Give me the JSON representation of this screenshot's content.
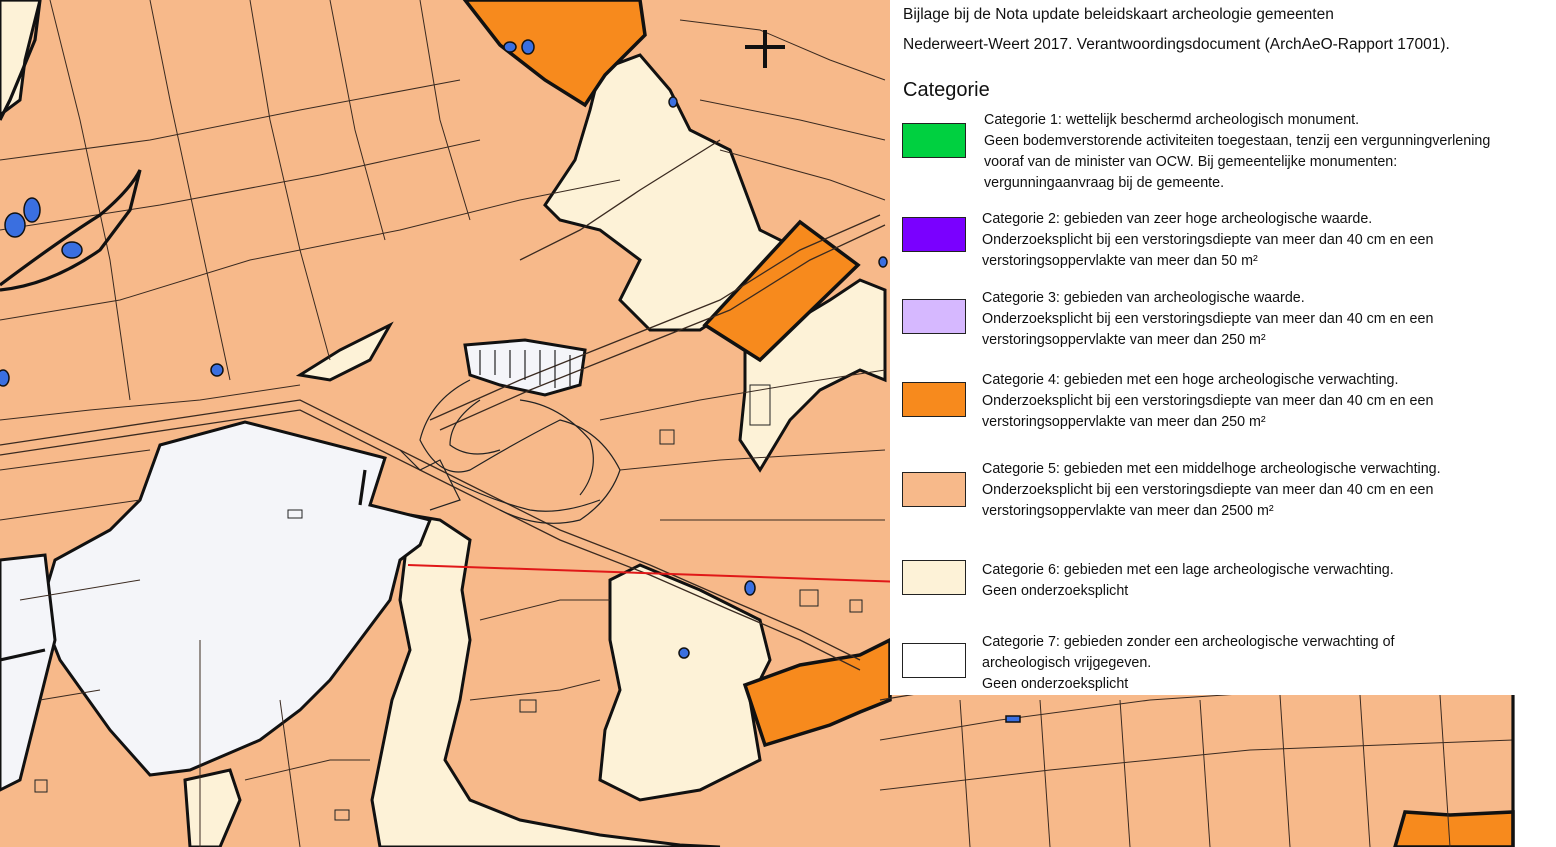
{
  "legend": {
    "header_line1": "Bijlage bij de Nota update beleidskaart archeologie gemeenten",
    "header_line2": "Nederweert-Weert 2017. Verantwoordingsdocument (ArchAeO-Rapport 17001).",
    "title": "Categorie",
    "entries": [
      {
        "color": "#00d040",
        "lines": [
          "Categorie 1: wettelijk beschermd archeologisch monument.",
          "Geen bodemverstorende activiteiten toegestaan, tenzij een vergunningverlening",
          "vooraf van de minister van OCW. Bij gemeentelijke monumenten:",
          "vergunningaanvraag bij de gemeente."
        ]
      },
      {
        "color": "#7a00ff",
        "lines": [
          "Categorie 2: gebieden van zeer hoge archeologische waarde.",
          "Onderzoeksplicht bij een verstoringsdiepte van meer dan 40 cm en een",
          "verstoringsoppervlakte van meer dan 50 m²"
        ]
      },
      {
        "color": "#d6b8ff",
        "lines": [
          "Categorie 3: gebieden van archeologische waarde.",
          "Onderzoeksplicht bij een verstoringsdiepte van meer dan 40 cm en een",
          "verstoringsoppervlakte van meer dan 250 m²"
        ]
      },
      {
        "color": "#f78a1d",
        "lines": [
          "Categorie 4: gebieden met een hoge archeologische verwachting.",
          "Onderzoeksplicht bij een verstoringsdiepte van meer dan 40 cm en een",
          "verstoringsoppervlakte van meer dan 250 m²"
        ]
      },
      {
        "color": "#f7b98a",
        "lines": [
          "Categorie 5: gebieden met een middelhoge archeologische verwachting.",
          "Onderzoeksplicht bij een verstoringsdiepte van meer dan 40 cm en een",
          "verstoringsoppervlakte van meer dan 2500 m²"
        ]
      },
      {
        "color": "#fdf2d7",
        "lines": [
          "Categorie 6: gebieden met een lage archeologische verwachting.",
          "Geen onderzoeksplicht"
        ]
      },
      {
        "color": "#ffffff",
        "lines": [
          "Categorie 7: gebieden zonder een archeologische verwachting of",
          "archeologisch vrijgegeven.",
          "Geen onderzoeksplicht"
        ]
      }
    ]
  },
  "map_colors": {
    "category4": "#f78a1d",
    "category5": "#f7b98a",
    "category6": "#fdf2d7",
    "category7": "#f4f5f9",
    "water": "#3a6fe0",
    "section_line": "#e01818",
    "boundary": "#111111"
  }
}
